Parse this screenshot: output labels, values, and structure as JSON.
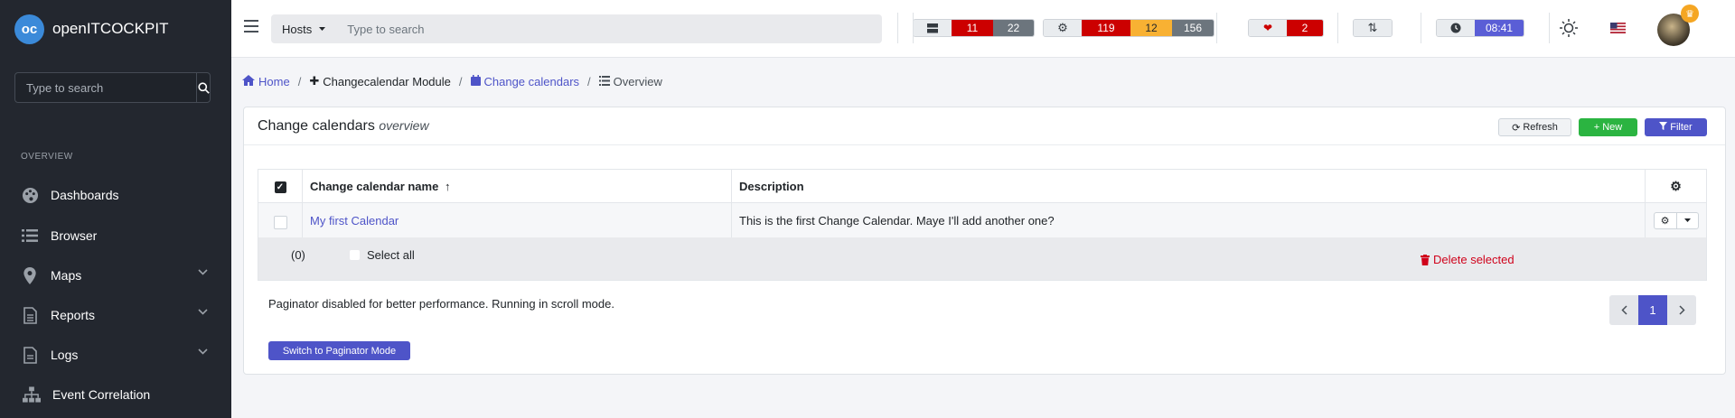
{
  "app": {
    "name": "openITCOCKPIT",
    "logo_text": "oc"
  },
  "sidebar": {
    "search_placeholder": "Type to search",
    "section": "OVERVIEW",
    "items": [
      {
        "label": "Dashboards",
        "icon": "palette-icon",
        "expandable": false
      },
      {
        "label": "Browser",
        "icon": "list-icon",
        "expandable": false
      },
      {
        "label": "Maps",
        "icon": "map-pin-icon",
        "expandable": true
      },
      {
        "label": "Reports",
        "icon": "file-icon",
        "expandable": true
      },
      {
        "label": "Logs",
        "icon": "document-icon",
        "expandable": true
      },
      {
        "label": "Event Correlation",
        "icon": "hierarchy-icon",
        "expandable": false
      }
    ]
  },
  "topbar": {
    "search_scope": "Hosts",
    "search_placeholder": "Type to search",
    "host_status": {
      "down": "11",
      "unreachable": "22"
    },
    "service_status": {
      "critical": "119",
      "warning": "12",
      "unknown": "156"
    },
    "health": "2",
    "time": "08:41",
    "colors": {
      "red": "#cc0000",
      "gray": "#6c757d",
      "yellow": "#f8b133",
      "purple": "#5a5ed6"
    }
  },
  "breadcrumb": {
    "home": "Home",
    "module": "Changecalendar Module",
    "page": "Change calendars",
    "current": "Overview"
  },
  "card": {
    "title": "Change calendars",
    "subtitle": "overview",
    "refresh": "Refresh",
    "new": "New",
    "filter": "Filter",
    "table": {
      "columns": [
        "Change calendar name",
        "Description"
      ],
      "rows": [
        {
          "name": "My first Calendar",
          "description": "This is the first Change Calendar. Maye I'll add another one?"
        }
      ]
    },
    "selected_count": "(0)",
    "select_all": "Select all",
    "delete_selected": "Delete selected",
    "paginator_message": "Paginator disabled for better performance. Running in scroll mode.",
    "current_page": "1",
    "switch_button": "Switch to Paginator Mode"
  }
}
